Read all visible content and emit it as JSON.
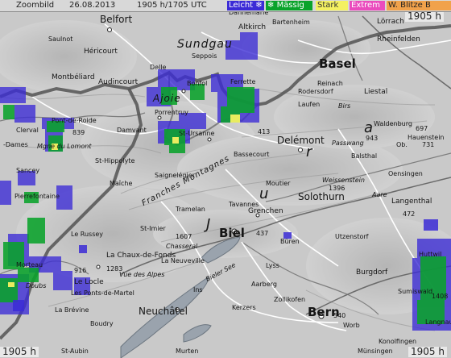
{
  "topbar": {
    "label": "Zoombild",
    "date": "26.08.2013",
    "time": "1905 h/1705 UTC"
  },
  "legend": [
    {
      "key": "leicht",
      "label": "Leicht",
      "icon": "snowflake-icon",
      "icon_char": "❄",
      "color": "#3b2bd6"
    },
    {
      "key": "massig",
      "label": "Mässig",
      "icon": "snowflake-icon",
      "icon_char": "❄",
      "color": "#0aa32b"
    },
    {
      "key": "stark",
      "label": "Stark",
      "color": "#f4f061"
    },
    {
      "key": "extrem",
      "label": "Extrem",
      "color": "#ea4bbd"
    },
    {
      "key": "blitze",
      "label": "W. Blitze",
      "label_suffix": "B",
      "color": "#f1a24b"
    }
  ],
  "timestamps": {
    "top_right": "1905 h",
    "bottom_left": "1905 h",
    "bottom_right": "1905 h"
  },
  "places": [
    {
      "name": "Belfort",
      "id": "belfort",
      "type": "medium"
    },
    {
      "name": "Altkirch",
      "id": "altkirch",
      "type": "small"
    },
    {
      "name": "Bartenheim",
      "id": "bartenheim",
      "type": "tiny"
    },
    {
      "name": "Dannemarie",
      "id": "dannemarie",
      "type": "tiny"
    },
    {
      "name": "Lörrach",
      "id": "loerrach",
      "type": "small"
    },
    {
      "name": "Rheinfelden",
      "id": "rheinfelden",
      "type": "small"
    },
    {
      "name": "Saulnot",
      "id": "saulnot",
      "type": "tiny"
    },
    {
      "name": "Héricourt",
      "id": "hericourt",
      "type": "small"
    },
    {
      "name": "Montbéliard",
      "id": "montbeliard",
      "type": "small"
    },
    {
      "name": "Audincourt",
      "id": "audincourt",
      "type": "small"
    },
    {
      "name": "Delle",
      "id": "delle",
      "type": "tiny"
    },
    {
      "name": "Bonfol",
      "id": "bonfol",
      "type": "tiny"
    },
    {
      "name": "Seppois",
      "id": "seppois",
      "type": "tiny"
    },
    {
      "name": "Basel",
      "id": "basel",
      "type": "large"
    },
    {
      "name": "Reinach",
      "id": "reinach",
      "type": "tiny"
    },
    {
      "name": "Rodersdorf",
      "id": "rodersdorf",
      "type": "tiny"
    },
    {
      "name": "Laufen",
      "id": "laufen",
      "type": "tiny"
    },
    {
      "name": "Liestal",
      "id": "liestal",
      "type": "small"
    },
    {
      "name": "Ferrette",
      "id": "ferrette",
      "type": "tiny"
    },
    {
      "name": "Porrentruy",
      "id": "porrentruy",
      "type": "tiny"
    },
    {
      "name": "Damvant",
      "id": "damvant",
      "type": "tiny"
    },
    {
      "name": "St-Ursanne",
      "id": "st-ursanne",
      "type": "tiny"
    },
    {
      "name": "Clerval",
      "id": "clerval",
      "type": "tiny"
    },
    {
      "name": "Pont-de-Roide",
      "id": "pont-de-roide",
      "type": "tiny"
    },
    {
      "name": "Mgne du Lomont",
      "id": "lomont",
      "type": "tiny"
    },
    {
      "name": "-Dames",
      "id": "dames",
      "type": "tiny"
    },
    {
      "name": "Sancey",
      "id": "sancey",
      "type": "tiny"
    },
    {
      "name": "St-Hippolyte",
      "id": "st-hippolyte",
      "type": "tiny"
    },
    {
      "name": "Pierrefontaine",
      "id": "pierrefontaine",
      "type": "tiny"
    },
    {
      "name": "Maîche",
      "id": "maiche",
      "type": "tiny"
    },
    {
      "name": "Saignelégier",
      "id": "saignelegier",
      "type": "tiny"
    },
    {
      "name": "Delémont",
      "id": "delemont",
      "type": "medium"
    },
    {
      "name": "Bassecourt",
      "id": "bassecourt",
      "type": "tiny"
    },
    {
      "name": "Passwang",
      "id": "passwang",
      "type": "tiny"
    },
    {
      "name": "Waldenburg",
      "id": "waldenburg",
      "type": "tiny"
    },
    {
      "name": "Balsthal",
      "id": "balsthal",
      "type": "tiny"
    },
    {
      "name": "Hauenstein",
      "id": "hauenstein",
      "type": "tiny"
    },
    {
      "name": "Ob.",
      "id": "ob",
      "type": "tiny"
    },
    {
      "name": "Oensingen",
      "id": "oensingen",
      "type": "tiny"
    },
    {
      "name": "Langenthal",
      "id": "langenthal",
      "type": "small"
    },
    {
      "name": "Weissenstein",
      "id": "weissenstein",
      "type": "tiny"
    },
    {
      "name": "Solothurn",
      "id": "solothurn",
      "type": "medium"
    },
    {
      "name": "Moutier",
      "id": "moutier",
      "type": "tiny"
    },
    {
      "name": "Aare",
      "id": "aare",
      "type": "tiny"
    },
    {
      "name": "Tavannes",
      "id": "tavannes",
      "type": "tiny"
    },
    {
      "name": "Grenchen",
      "id": "grenchen",
      "type": "small"
    },
    {
      "name": "Tramelan",
      "id": "tramelan",
      "type": "tiny"
    },
    {
      "name": "Le Russey",
      "id": "le-russey",
      "type": "tiny"
    },
    {
      "name": "St-Imier",
      "id": "st-imier",
      "type": "tiny"
    },
    {
      "name": "Chasseral",
      "id": "chasseral",
      "type": "tiny"
    },
    {
      "name": "Biel",
      "id": "biel",
      "type": "large"
    },
    {
      "name": "Büren",
      "id": "bueren",
      "type": "tiny"
    },
    {
      "name": "Utzenstorf",
      "id": "utzenstorf",
      "type": "tiny"
    },
    {
      "name": "Burgdorf",
      "id": "burgdorf",
      "type": "small"
    },
    {
      "name": "Huttwil",
      "id": "huttwil",
      "type": "tiny"
    },
    {
      "name": "Sumiswald",
      "id": "sumiswald",
      "type": "tiny"
    },
    {
      "name": "La Chaux-de-Fonds",
      "id": "la-chaux-de-fonds",
      "type": "small"
    },
    {
      "name": "La Neuveville",
      "id": "la-neuveville",
      "type": "tiny"
    },
    {
      "name": "Vue des Alpes",
      "id": "vue-des-alpes",
      "type": "tiny"
    },
    {
      "name": "Morteau",
      "id": "morteau",
      "type": "tiny"
    },
    {
      "name": "Le Locle",
      "id": "le-locle",
      "type": "small"
    },
    {
      "name": "Doubs",
      "id": "doubs",
      "type": "tiny"
    },
    {
      "name": "Les Ponts-de-Martel",
      "id": "les-ponts",
      "type": "tiny"
    },
    {
      "name": "Lyss",
      "id": "lyss",
      "type": "tiny"
    },
    {
      "name": "Aarberg",
      "id": "aarberg",
      "type": "tiny"
    },
    {
      "name": "Ins",
      "id": "ins",
      "type": "tiny"
    },
    {
      "name": "Zollikofen",
      "id": "zollikofen",
      "type": "tiny"
    },
    {
      "name": "Bern",
      "id": "bern",
      "type": "large"
    },
    {
      "name": "Worb",
      "id": "worb",
      "type": "tiny"
    },
    {
      "name": "Langnau",
      "id": "langnau",
      "type": "tiny"
    },
    {
      "name": "La Brévine",
      "id": "la-brevine",
      "type": "tiny"
    },
    {
      "name": "Boudry",
      "id": "boudry",
      "type": "tiny"
    },
    {
      "name": "Neuchâtel",
      "id": "neuchatel",
      "type": "medium"
    },
    {
      "name": "Murten",
      "id": "murten",
      "type": "tiny"
    },
    {
      "name": "Kerzers",
      "id": "kerzers",
      "type": "tiny"
    },
    {
      "name": "Konolfingen",
      "id": "konolfingen",
      "type": "tiny"
    },
    {
      "name": "Münsingen",
      "id": "muensingen",
      "type": "tiny"
    },
    {
      "name": "St-Aubin",
      "id": "st-aubin",
      "type": "tiny"
    },
    {
      "name": "Birs",
      "id": "birs",
      "type": "tiny"
    },
    {
      "name": "Bieler See",
      "id": "bieler-see",
      "type": "tiny"
    }
  ],
  "regions": [
    {
      "text": "Sundgau",
      "id": "sundgau"
    },
    {
      "text": "Franches Montagnes",
      "id": "franches-montagnes"
    },
    {
      "text": "Ajoie",
      "id": "ajoie"
    },
    {
      "text": "J",
      "id": "jura-j"
    },
    {
      "text": "u",
      "id": "jura-u"
    },
    {
      "text": "r",
      "id": "jura-r"
    },
    {
      "text": "a",
      "id": "jura-a"
    }
  ],
  "elevations": [
    {
      "value": "839",
      "id": "el-839"
    },
    {
      "value": "943",
      "id": "el-943"
    },
    {
      "value": "697",
      "id": "el-697"
    },
    {
      "value": "731",
      "id": "el-731"
    },
    {
      "value": "413",
      "id": "el-413"
    },
    {
      "value": "1396",
      "id": "el-1396"
    },
    {
      "value": "1607",
      "id": "el-1607"
    },
    {
      "value": "1283",
      "id": "el-1283"
    },
    {
      "value": "916",
      "id": "el-916"
    },
    {
      "value": "437",
      "id": "el-437"
    },
    {
      "value": "540",
      "id": "el-540"
    },
    {
      "value": "1408",
      "id": "el-1408"
    },
    {
      "value": "472",
      "id": "el-472"
    }
  ],
  "map_colors": {
    "terrain": "#c8c8c8",
    "border": "#5b5b5b",
    "road": "#ffffff",
    "water": "#2f2fcc",
    "precip_leicht": "#3b2bd6",
    "precip_massig": "#0aa32b",
    "precip_stark": "#f4f061"
  }
}
